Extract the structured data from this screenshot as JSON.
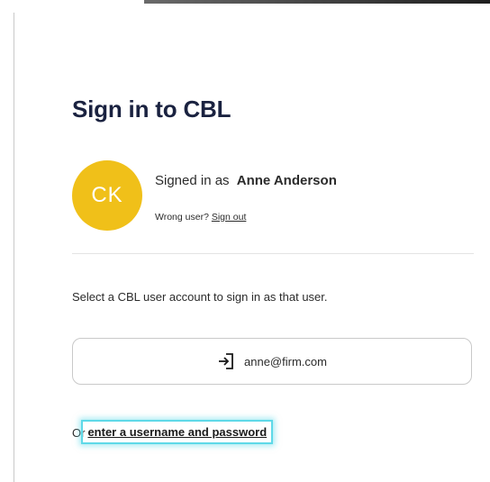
{
  "page": {
    "title": "Sign in to CBL"
  },
  "user": {
    "initials": "CK",
    "signed_in_prefix": "Signed in as",
    "name": "Anne Anderson",
    "wrong_user_text": "Wrong user?",
    "sign_out_label": "Sign out"
  },
  "accounts": {
    "instruction": "Select a CBL user account to sign in as that user.",
    "items": [
      {
        "email": "anne@firm.com",
        "icon": "sign-in-icon"
      }
    ]
  },
  "alternative": {
    "prefix": "Or",
    "link_label": "enter a username and password"
  },
  "colors": {
    "avatar_bg": "#f0c019",
    "title": "#1a2240",
    "highlight": "#5fd9e8"
  }
}
